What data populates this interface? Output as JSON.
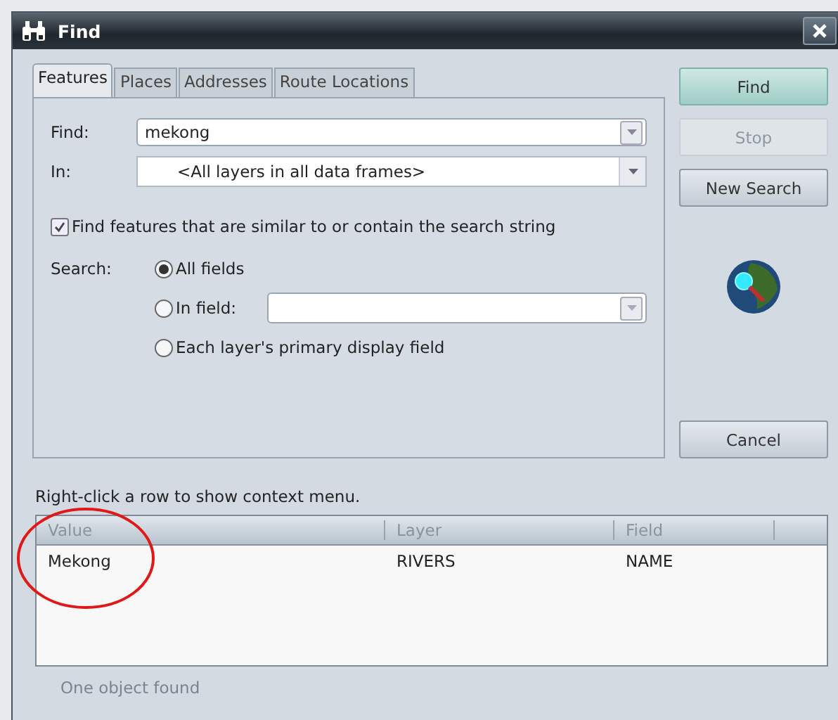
{
  "window": {
    "title": "Find"
  },
  "tabs": [
    {
      "label": "Features",
      "selected": true
    },
    {
      "label": "Places",
      "selected": false
    },
    {
      "label": "Addresses",
      "selected": false
    },
    {
      "label": "Route Locations",
      "selected": false
    }
  ],
  "find": {
    "label": "Find:",
    "value": "mekong"
  },
  "in": {
    "label": "In:",
    "value": "<All layers in all data frames>"
  },
  "similar": {
    "label": "Find features that are similar to or contain the search string",
    "checked": true
  },
  "search": {
    "label": "Search:",
    "options": [
      {
        "label": "All fields",
        "selected": true,
        "kind": "plain"
      },
      {
        "label": "In field:",
        "selected": false,
        "kind": "field"
      },
      {
        "label": "Each layer's primary display field",
        "selected": false,
        "kind": "plain"
      }
    ]
  },
  "actions": [
    {
      "label": "Find",
      "default": true,
      "disabled": false
    },
    {
      "label": "Stop",
      "default": false,
      "disabled": true
    },
    {
      "label": "New Search",
      "default": false,
      "disabled": false
    }
  ],
  "cancel": {
    "label": "Cancel"
  },
  "hint": "Right-click a row to show context menu.",
  "results": {
    "columns": [
      "Value",
      "Layer",
      "Field"
    ],
    "rows": [
      {
        "cells": [
          "Mekong",
          "RIVERS",
          "NAME"
        ]
      }
    ]
  },
  "status_bar": "One object found"
}
